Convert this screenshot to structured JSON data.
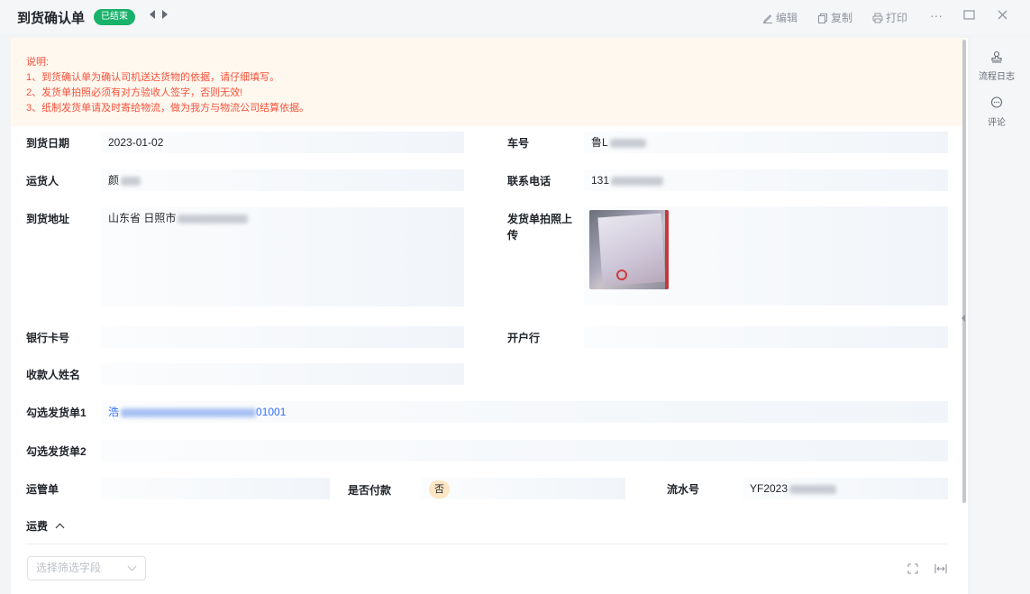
{
  "header": {
    "title": "到货确认单",
    "status": "已结束",
    "edit_label": "编辑",
    "copy_label": "复制",
    "print_label": "打印",
    "more_label": "···"
  },
  "notice": {
    "lines": [
      "说明:",
      "1、到货确认单为确认司机送达货物的依据，请仔细填写。",
      "2、发货单拍照必须有对方验收人签字，否则无效!",
      "3、纸制发货单请及时寄给物流，做为我方与物流公司结算依据。"
    ]
  },
  "form": {
    "arrival_date": {
      "label": "到货日期",
      "value": "2023-01-02"
    },
    "plate_no": {
      "label": "车号",
      "value": "鲁L"
    },
    "shipper": {
      "label": "运货人",
      "value": "颜"
    },
    "phone": {
      "label": "联系电话",
      "value": "131"
    },
    "address": {
      "label": "到货地址",
      "value": "山东省 日照市"
    },
    "photo_upload": {
      "label": "发货单拍照上传"
    },
    "bank_card": {
      "label": "银行卡号",
      "value": ""
    },
    "bank": {
      "label": "开户行",
      "value": ""
    },
    "payee": {
      "label": "收款人姓名",
      "value": ""
    },
    "invoice1": {
      "label": "勾选发货单1",
      "value_prefix": "浩",
      "value_suffix": "01001"
    },
    "invoice2": {
      "label": "勾选发货单2",
      "value": ""
    },
    "waybill": {
      "label": "运管单",
      "value": ""
    },
    "paid": {
      "label": "是否付款",
      "value": "否"
    },
    "serial": {
      "label": "流水号",
      "value": "YF2023"
    }
  },
  "freight": {
    "title": "运费",
    "select_placeholder": "选择筛选字段"
  },
  "sidebar": {
    "log_label": "流程日志",
    "comment_label": "评论"
  },
  "colors": {
    "status_green": "#19b26b",
    "notice_red": "#f5523b",
    "notice_bg": "#fff8ef",
    "link_blue": "#3370ff"
  }
}
